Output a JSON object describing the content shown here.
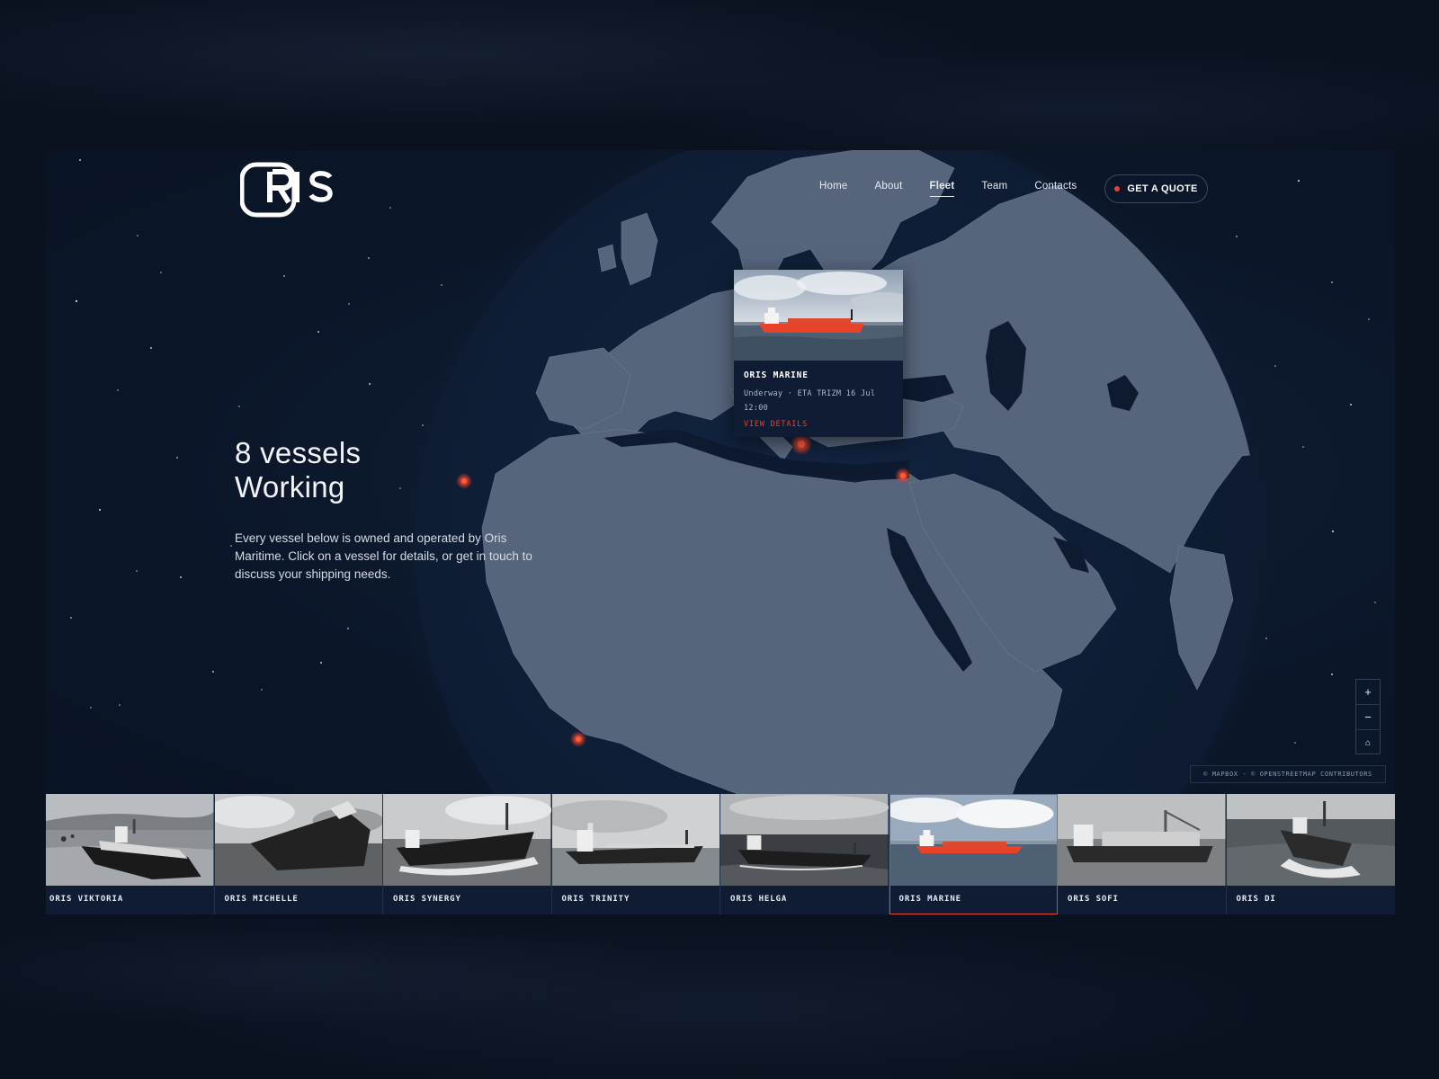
{
  "brand": {
    "logo_text": "ORIS"
  },
  "nav": {
    "items": [
      {
        "label": "Home",
        "active": false
      },
      {
        "label": "About",
        "active": false
      },
      {
        "label": "Fleet",
        "active": true
      },
      {
        "label": "Team",
        "active": false
      },
      {
        "label": "Contacts",
        "active": false
      }
    ],
    "cta_label": "GET A QUOTE"
  },
  "hero": {
    "title_line1": "8 vessels",
    "title_line2": "Working",
    "description": "Every vessel below is owned and operated by Oris Maritime. Click on a vessel for details, or get in touch to discuss your shipping needs."
  },
  "popup": {
    "vessel_name": "ORIS MARINE",
    "status": "Underway · ETA TRIZM 16 Jul 12:00",
    "link_label": "VIEW DETAILS"
  },
  "map_controls": {
    "zoom_in": "+",
    "zoom_out": "−",
    "reset": "⌂"
  },
  "attribution": "© MAPBOX - © OPENSTREETMAP CONTRIBUTORS",
  "vessels": [
    {
      "name": "ORIS VIKTORIA",
      "selected": false
    },
    {
      "name": "ORIS MICHELLE",
      "selected": false
    },
    {
      "name": "ORIS SYNERGY",
      "selected": false
    },
    {
      "name": "ORIS TRINITY",
      "selected": false
    },
    {
      "name": "ORIS HELGA",
      "selected": false
    },
    {
      "name": "ORIS MARINE",
      "selected": true
    },
    {
      "name": "ORIS SOFI",
      "selected": false
    },
    {
      "name": "ORIS DI",
      "selected": false
    }
  ],
  "colors": {
    "accent": "#e8432a",
    "background": "#0a1220",
    "panel": "#0f1c33",
    "land": "#56647c",
    "ocean": "#0d1a2f"
  }
}
